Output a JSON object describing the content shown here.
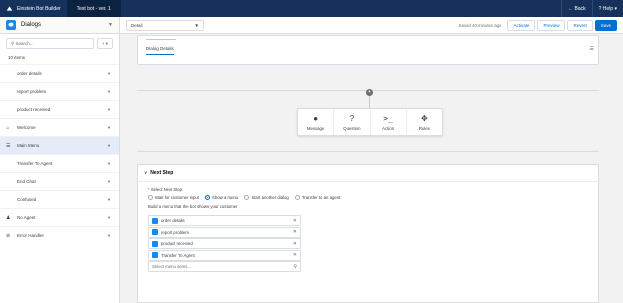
{
  "topbar": {
    "app_name": "Einstein Bot Builder",
    "bot_name": "Test bot - ver. 1",
    "back_label": "Back",
    "help_label": "Help"
  },
  "sidebar": {
    "title": "Dialogs",
    "search_placeholder": "Search...",
    "add_label": "+ ▾",
    "count": "10 items",
    "items": [
      {
        "label": "order details"
      },
      {
        "label": "report problem"
      },
      {
        "label": "product received"
      },
      {
        "label": "Welcome"
      },
      {
        "label": "Main Menu"
      },
      {
        "label": "Transfer To Agent"
      },
      {
        "label": "End Chat"
      },
      {
        "label": "Confused"
      },
      {
        "label": "No Agent"
      },
      {
        "label": "Error Handler"
      }
    ]
  },
  "toolbar": {
    "view_select": "Detail",
    "saved_text": "Saved 40 minutes ago",
    "activate_label": "Activate",
    "preview_label": "Preview",
    "revert_label": "Revert",
    "save_label": "Save"
  },
  "dialog_details": {
    "tab_label": "Dialog Details"
  },
  "actions": [
    {
      "label": "Message",
      "icon": "message-icon"
    },
    {
      "label": "Question",
      "icon": "question-icon"
    },
    {
      "label": "Action",
      "icon": "action-icon"
    },
    {
      "label": "Rules",
      "icon": "rules-icon"
    }
  ],
  "next_step": {
    "title": "Next Step",
    "select_label": "Select Next Step",
    "options": [
      {
        "label": "Wait for customer input",
        "selected": false
      },
      {
        "label": "Show a menu",
        "selected": true
      },
      {
        "label": "Start another dialog",
        "selected": false
      },
      {
        "label": "Transfer to an agent",
        "selected": false
      }
    ],
    "hint": "Build a menu that the bot shows your customer",
    "menu_items": [
      {
        "label": "order details"
      },
      {
        "label": "report problem"
      },
      {
        "label": "product received"
      },
      {
        "label": "Transfer To Agent"
      }
    ],
    "search_placeholder": "Select menu items..."
  },
  "colors": {
    "topbar": "#16325c",
    "accent": "#0070d2",
    "dialog_icon": "#1589ee"
  }
}
